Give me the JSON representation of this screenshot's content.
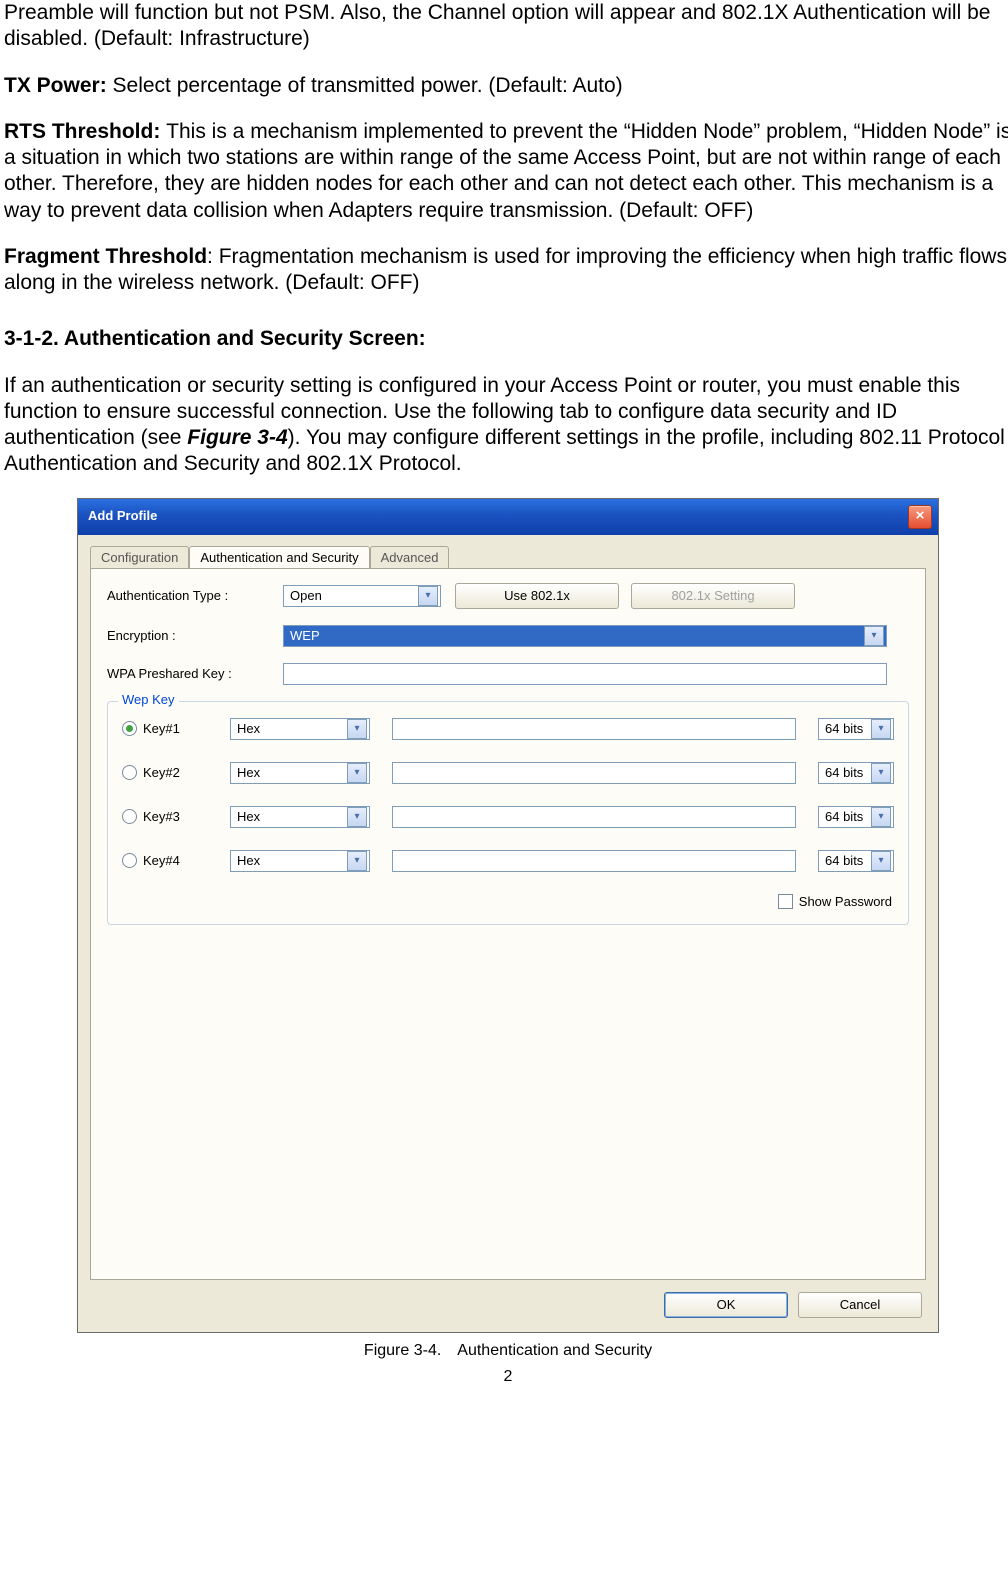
{
  "paragraphs": {
    "p1": "Preamble will function but not PSM. Also, the Channel option will appear and 802.1X Authentication will be disabled. (Default: Infrastructure)",
    "tx_label": "TX Power: ",
    "tx_text": "Select percentage of transmitted power. (Default: Auto)",
    "rts_label": "RTS Threshold: ",
    "rts_text": "This is a mechanism implemented to prevent the “Hidden Node” problem, “Hidden Node” is a situation in which two stations are within range of the same Access Point, but are not within range of each other. Therefore, they are hidden nodes for each other and can not detect each other. This mechanism is a way to prevent data collision when Adapters require transmission. (Default: OFF)",
    "frag_label": "Fragment Threshold",
    "frag_text": ": Fragmentation mechanism is used for improving the efficiency when high traffic flows along in the wireless network. (Default: OFF)"
  },
  "section_head": "3-1-2. Authentication and Security Screen:",
  "intro": {
    "part1": "If an authentication or security setting is configured in your Access Point or router, you must enable this function to ensure successful connection. Use the following tab to configure data security and ID authentication (see ",
    "figref": "Figure 3-4",
    "part2": "). You may configure different settings in the profile, including 802.11 Protocol Authentication and Security and 802.1X Protocol."
  },
  "dialog": {
    "title": "Add Profile",
    "tabs": {
      "config": "Configuration",
      "auth": "Authentication and Security",
      "adv": "Advanced"
    },
    "labels": {
      "authtype": "Authentication Type :",
      "encryption": "Encryption :",
      "wpapsk": "WPA Preshared Key :",
      "use8021x": "Use 802.1x",
      "setting8021x": "802.1x Setting"
    },
    "values": {
      "authtype": "Open",
      "encryption": "WEP"
    },
    "wep": {
      "legend": "Wep Key",
      "keys": [
        {
          "label": "Key#1",
          "format": "Hex",
          "bits": "64 bits",
          "selected": true
        },
        {
          "label": "Key#2",
          "format": "Hex",
          "bits": "64 bits",
          "selected": false
        },
        {
          "label": "Key#3",
          "format": "Hex",
          "bits": "64 bits",
          "selected": false
        },
        {
          "label": "Key#4",
          "format": "Hex",
          "bits": "64 bits",
          "selected": false
        }
      ],
      "showpw": "Show Password"
    },
    "buttons": {
      "ok": "OK",
      "cancel": "Cancel"
    }
  },
  "figure_caption": "Figure 3-4. Authentication and Security",
  "page_number": "2"
}
